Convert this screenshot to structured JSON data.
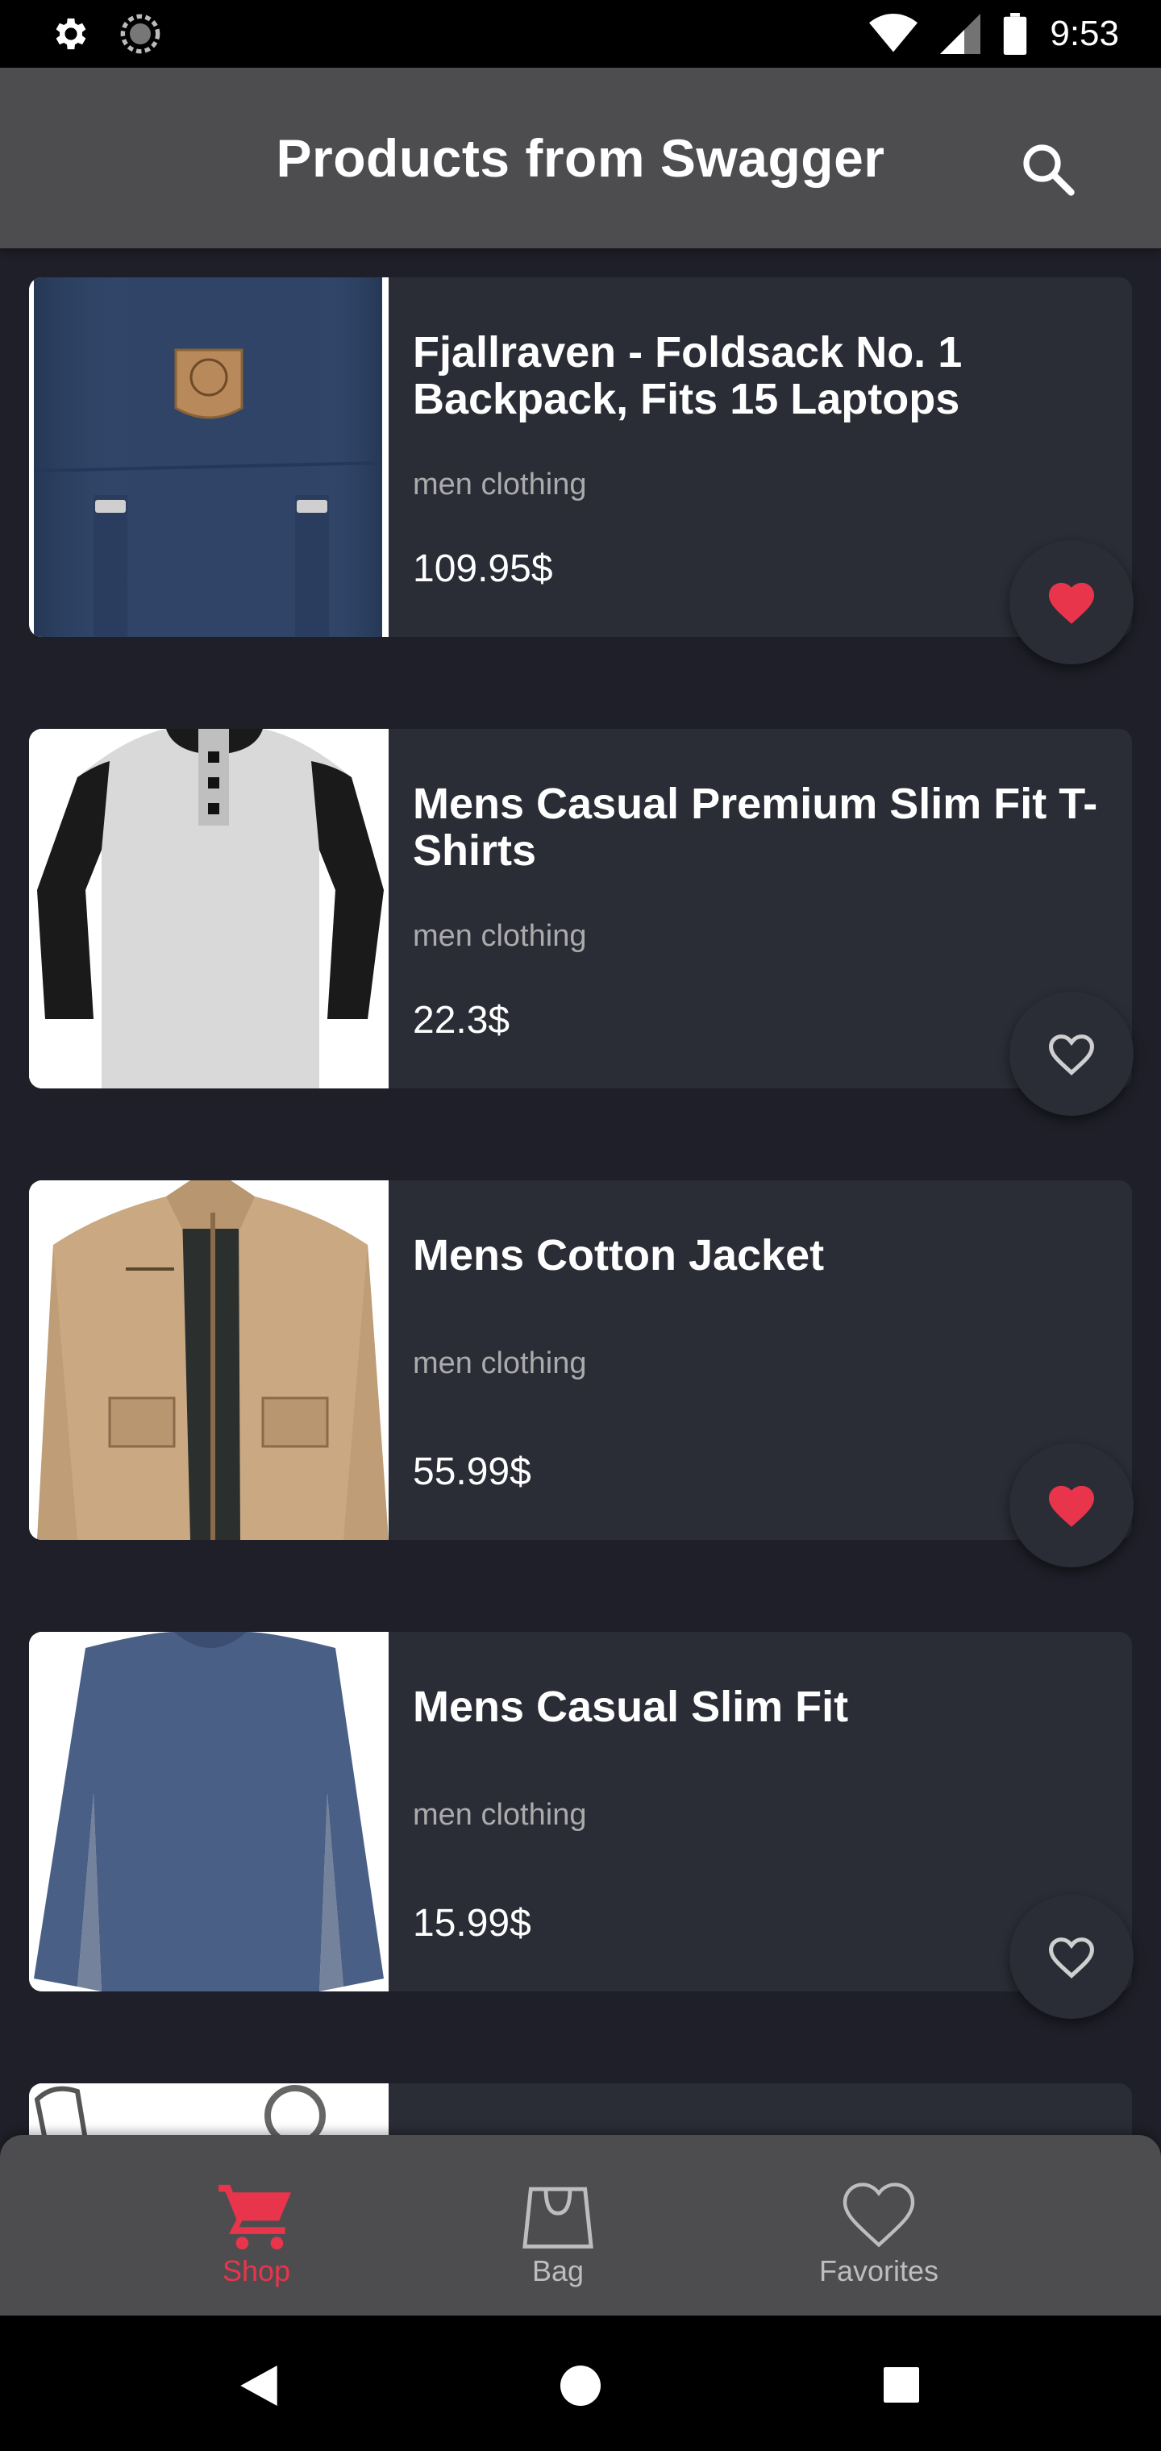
{
  "status_bar": {
    "time": "9:53",
    "icons": [
      "settings-icon",
      "sync-icon",
      "wifi-icon",
      "signal-icon",
      "battery-icon"
    ]
  },
  "app_bar": {
    "title": "Products from Swagger",
    "search_icon": "search-icon"
  },
  "products": [
    {
      "title": "Fjallraven - Foldsack No. 1 Backpack, Fits 15 Laptops",
      "category": "men clothing",
      "price": "109.95$",
      "favorite": true,
      "image": "backpack"
    },
    {
      "title": "Mens Casual Premium Slim Fit T-Shirts",
      "category": "men clothing",
      "price": "22.3$",
      "favorite": false,
      "image": "tshirt"
    },
    {
      "title": "Mens Cotton Jacket",
      "category": "men clothing",
      "price": "55.99$",
      "favorite": true,
      "image": "jacket"
    },
    {
      "title": "Mens Casual Slim Fit",
      "category": "men clothing",
      "price": "15.99$",
      "favorite": false,
      "image": "longsleeve"
    }
  ],
  "bottom_nav": {
    "items": [
      {
        "label": "Shop",
        "icon": "cart-icon",
        "active": true
      },
      {
        "label": "Bag",
        "icon": "bag-icon",
        "active": false
      },
      {
        "label": "Favorites",
        "icon": "heart-icon",
        "active": false
      }
    ]
  },
  "colors": {
    "accent": "#e8354b",
    "background": "#1e1f28",
    "card": "#2a2c36",
    "app_bar": "#4d4d4f"
  }
}
